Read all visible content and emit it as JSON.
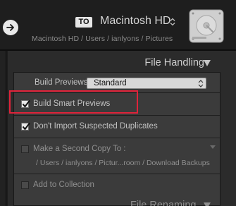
{
  "destination": {
    "to_badge": "TO",
    "title": "Macintosh HD",
    "path": "Macintosh HD / Users / ianlyons / Pictures",
    "drive_icon": "hard-drive-icon"
  },
  "panel": {
    "title": "File Handling",
    "build_previews": {
      "label": "Build Previews",
      "value": "Standard"
    },
    "build_smart_previews": {
      "label": "Build Smart Previews",
      "checked": true
    },
    "dont_import_duplicates": {
      "label": "Don't Import Suspected Duplicates",
      "checked": true
    },
    "second_copy": {
      "label": "Make a Second Copy To :",
      "path": "/ Users / ianlyons / Pictur...room / Download Backups",
      "checked": false
    },
    "add_to_collection": {
      "label": "Add to Collection",
      "checked": false
    }
  },
  "next_panel": {
    "title": "File Renaming"
  },
  "colors": {
    "highlight": "#e0233a",
    "panel_bg": "#2b2b2b",
    "content_bg": "#3b3b3b"
  }
}
